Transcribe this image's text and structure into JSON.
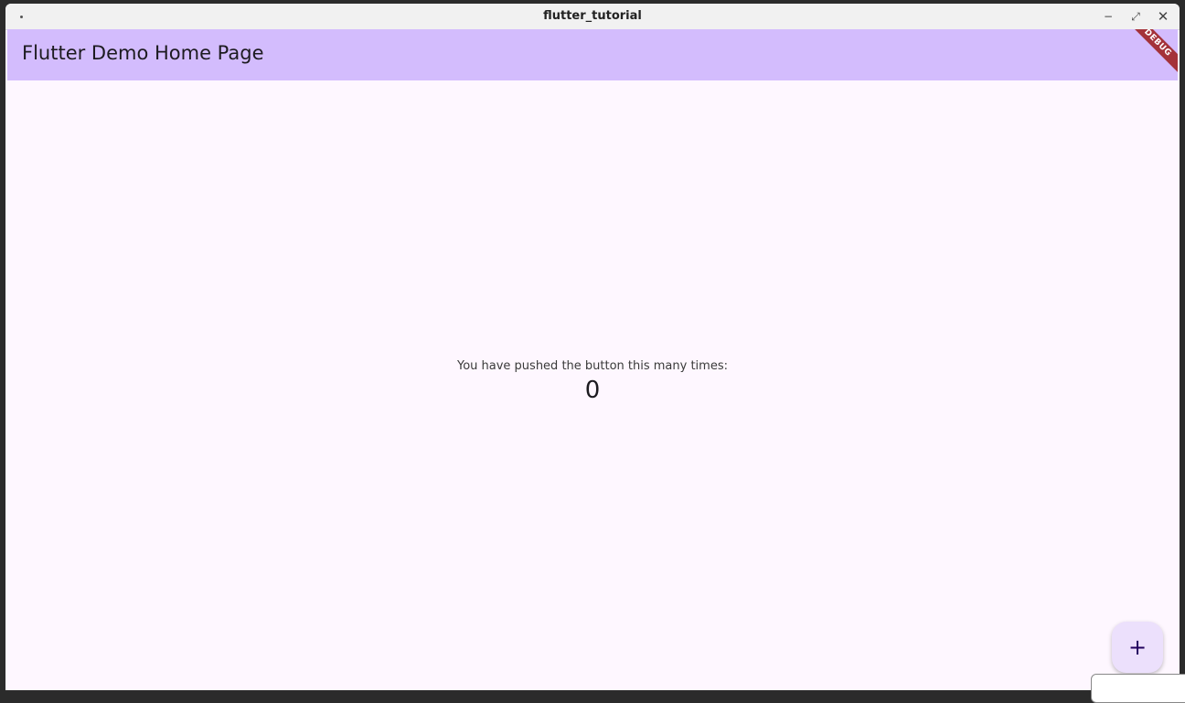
{
  "window": {
    "title": "flutter_tutorial",
    "controls": {
      "minimize": "−",
      "maximize": "⤢",
      "close": "✕"
    }
  },
  "appbar": {
    "title": "Flutter Demo Home Page",
    "banner": "DEBUG"
  },
  "counter": {
    "label": "You have pushed the button this many times:",
    "value": "0"
  },
  "fab": {
    "icon": "add-icon",
    "symbol": "+"
  },
  "colors": {
    "appbar": "#d3bcfd",
    "background": "#fef7ff",
    "fab": "#ece0fc",
    "banner": "#a4323a"
  }
}
